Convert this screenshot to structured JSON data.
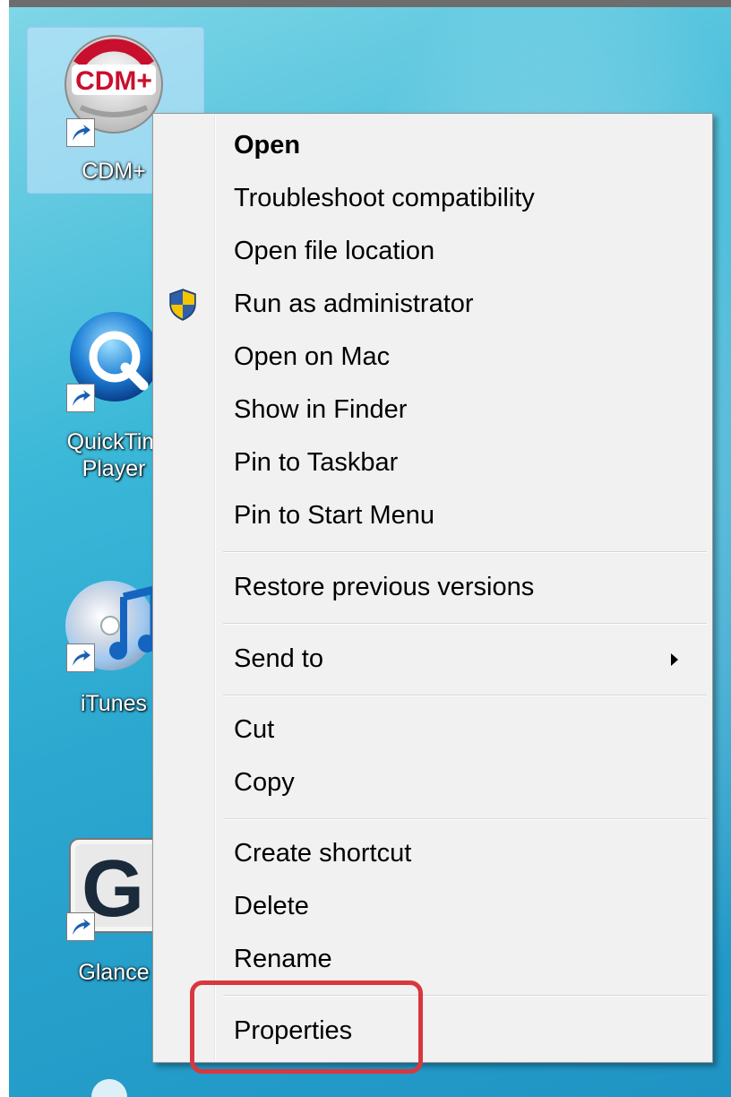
{
  "desktop": {
    "icons": [
      {
        "label": "CDM+",
        "logo_text": "CDM+",
        "selected": true,
        "icon": "cdm-app-icon"
      },
      {
        "label_line1": "QuickTim",
        "label_line2": "Player",
        "icon": "quicktime-icon"
      },
      {
        "label": "iTunes",
        "icon": "itunes-icon"
      },
      {
        "label": "Glance",
        "logo_text": "G",
        "icon": "glance-icon"
      }
    ]
  },
  "context_menu": {
    "items": [
      {
        "label": "Open",
        "bold": true
      },
      {
        "label": "Troubleshoot compatibility"
      },
      {
        "label": "Open file location"
      },
      {
        "label": "Run as administrator",
        "icon": "uac-shield-icon"
      },
      {
        "label": "Open on Mac"
      },
      {
        "label": "Show in Finder"
      },
      {
        "label": "Pin to Taskbar"
      },
      {
        "label": "Pin to Start Menu"
      },
      {
        "label": "Restore previous versions"
      },
      {
        "label": "Send to",
        "submenu": true
      },
      {
        "label": "Cut"
      },
      {
        "label": "Copy"
      },
      {
        "label": "Create shortcut"
      },
      {
        "label": "Delete"
      },
      {
        "label": "Rename"
      },
      {
        "label": "Properties",
        "highlighted": true
      }
    ]
  },
  "colors": {
    "highlight_border": "#d9373f",
    "menu_background": "#f1f1f1",
    "desktop_background": "#2aa6cf"
  }
}
